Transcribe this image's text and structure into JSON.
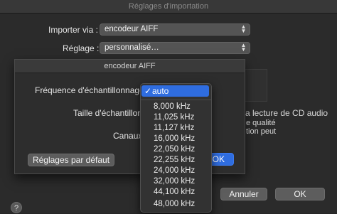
{
  "window": {
    "title": "Réglages d'importation"
  },
  "main": {
    "import_label": "Importer via :",
    "import_value": "encodeur AIFF",
    "setting_label": "Réglage :",
    "setting_value": "personnalisé…",
    "behind_line1": "a lecture de CD audio",
    "behind_line2": "e qualité",
    "behind_line3": "tion peut",
    "help_icon": "?",
    "cancel_button": "Annuler",
    "ok_button": "OK"
  },
  "sheet": {
    "title": "encodeur AIFF",
    "sample_rate_label": "Fréquence d'échantillonnage :",
    "sample_size_label": "Taille d'échantillon",
    "channels_label": "Canaux",
    "defaults_button": "Réglages par défaut",
    "ok_button": "OK"
  },
  "menu": {
    "selected_check": "✓",
    "selected": "auto",
    "items": [
      "8,000 kHz",
      "11,025 kHz",
      "11,127 kHz",
      "16,000 kHz",
      "22,050 kHz",
      "22,255 kHz",
      "24,000 kHz",
      "32,000 kHz",
      "44,100 kHz",
      "48,000 kHz"
    ]
  },
  "colors": {
    "accent": "#2f6de0",
    "background": "#2b2b2b"
  }
}
